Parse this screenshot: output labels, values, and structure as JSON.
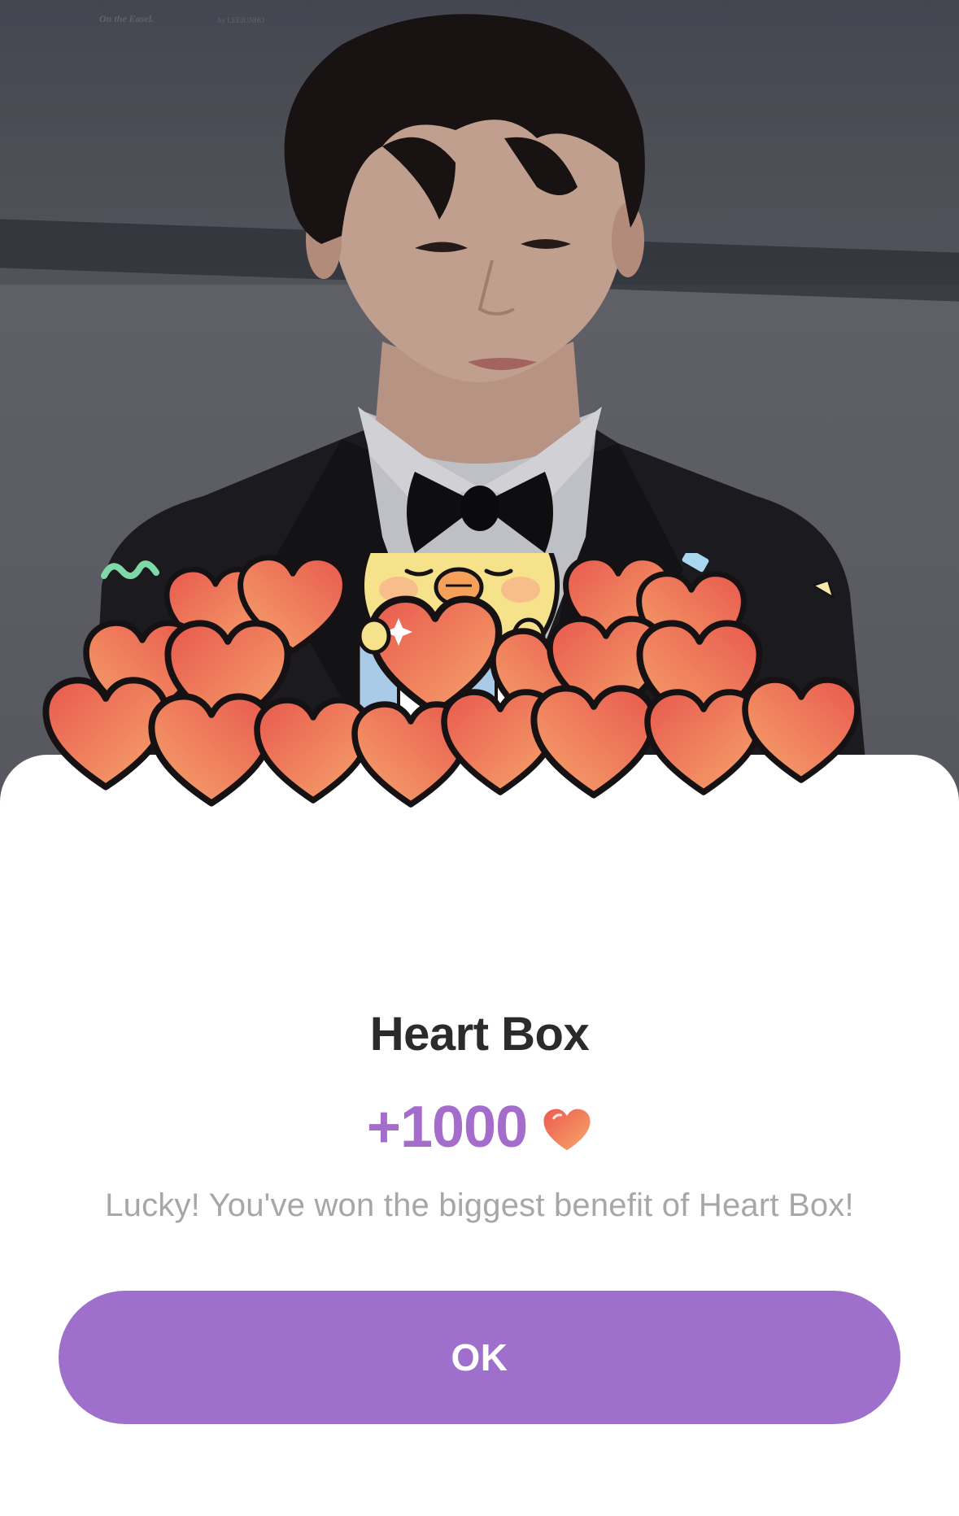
{
  "backdrop": {
    "watermark_left": "On the Easel.",
    "watermark_right": "by LEEJUNHO"
  },
  "dialog": {
    "title": "Heart Box",
    "amount": "+1000",
    "amount_icon": "heart-icon",
    "message": "Lucky! You've won the biggest benefit of Heart Box!",
    "ok_label": "OK"
  },
  "colors": {
    "accent": "#9f6fcc",
    "amount_text": "#a46dcc",
    "title_text": "#2b2b2b",
    "message_text": "#a7a7a7",
    "heart_light": "#f6a06a",
    "heart_dark": "#e8594e",
    "chick": "#f5e28a"
  }
}
